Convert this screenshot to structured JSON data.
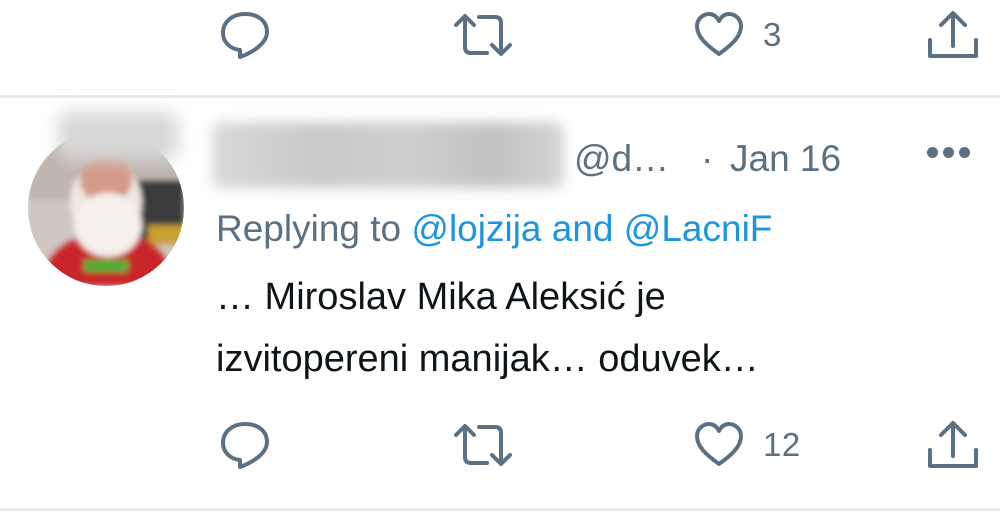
{
  "previous_tweet": {
    "actions": {
      "like_count": "3"
    }
  },
  "tweet": {
    "author": {
      "handle": "@d…"
    },
    "separator": "·",
    "date": "Jan 16",
    "replying": {
      "prefix": "Replying to",
      "mention_1": "@lojzija",
      "conjunction": "and",
      "mention_2": "@LacniF"
    },
    "text_lines": [
      "… Miroslav Mika Aleksić je",
      "izvitopereni manijak… oduvek…"
    ],
    "actions": {
      "like_count": "12"
    }
  },
  "icons": {
    "reply": "reply-icon",
    "retweet": "retweet-icon",
    "like": "heart-icon",
    "share": "share-icon",
    "more": "more-icon"
  },
  "colors": {
    "muted": "#5b7083",
    "link": "#1b95e0",
    "text": "#0f1419",
    "divider": "#e7ebef"
  }
}
